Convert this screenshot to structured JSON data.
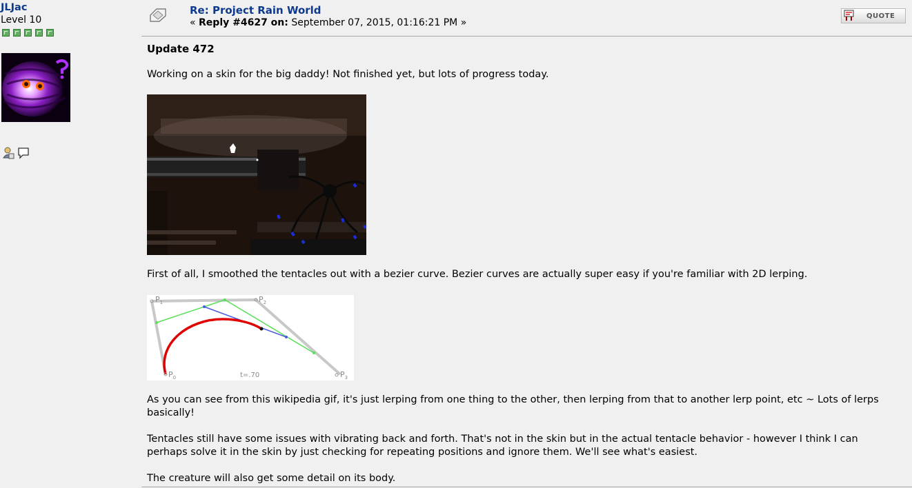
{
  "poster": {
    "name": "JLJac",
    "level": "Level 10",
    "stars": 5
  },
  "post": {
    "subject": "Re: Project Rain World",
    "reply_prefix": "« ",
    "reply_label": "Reply #4627 on:",
    "reply_date": " September 07, 2015, 01:16:21 PM »",
    "quote_label": "QUOTE"
  },
  "content": {
    "title": "Update 472",
    "p1": "Working on a skin for the big daddy! Not finished yet, but lots of progress today.",
    "p2": "First of all, I smoothed the tentacles out with a bezier curve. Bezier curves are actually super easy if you're familiar with 2D lerping.",
    "p3": "As you can see from this wikipedia gif, it's just lerping from one thing to the other, then lerping from that to another lerp point, etc ~ Lots of lerps basically!",
    "p4": "Tentacles still have some issues with vibrating back and forth. That's not in the skin but in the actual tentacle behavior - however I think I can perhaps solve it in the skin by just checking for repeating positions and ignore them. We'll see what's easiest.",
    "p5": "The creature will also get some detail on its body."
  },
  "bezier_labels": {
    "p0": "P",
    "p0_sub": "0",
    "p1": "P",
    "p1_sub": "1",
    "p2": "P",
    "p2_sub": "2",
    "p3": "P",
    "p3_sub": "3",
    "t": "t=.70"
  },
  "colors": {
    "link": "#0d3a8c",
    "curve": "#e00000",
    "lerp1": "#55e055",
    "lerp2": "#4a5ae0",
    "hull": "#c8c8c8"
  }
}
